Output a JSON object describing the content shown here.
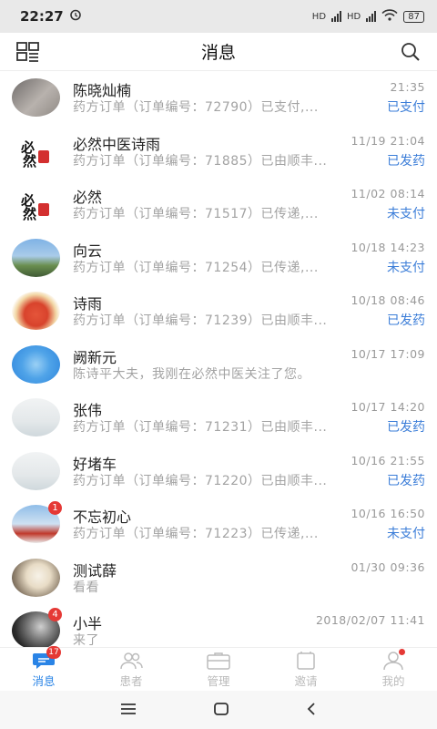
{
  "status_bar": {
    "time": "22:27",
    "network_label": "HD",
    "battery": "87"
  },
  "header": {
    "title": "消息",
    "left_icon": "qr-scan-icon",
    "right_icon": "search-icon"
  },
  "messages": [
    {
      "name": "陈晓灿楠",
      "time": "21:35",
      "preview": "药方订单（订单编号：72790）已支付,...",
      "status": "已支付",
      "badge": ""
    },
    {
      "name": "必然中医诗雨",
      "time": "11/19  21:04",
      "preview": "药方订单（订单编号：71885）已由顺丰...",
      "status": "已发药",
      "badge": ""
    },
    {
      "name": "必然",
      "time": "11/02  08:14",
      "preview": "药方订单（订单编号：71517）已传递,...",
      "status": "未支付",
      "badge": ""
    },
    {
      "name": "向云",
      "time": "10/18  14:23",
      "preview": "药方订单（订单编号：71254）已传递,...",
      "status": "未支付",
      "badge": ""
    },
    {
      "name": "诗雨",
      "time": "10/18  08:46",
      "preview": "药方订单（订单编号：71239）已由顺丰...",
      "status": "已发药",
      "badge": ""
    },
    {
      "name": "阙新元",
      "time": "10/17  17:09",
      "preview": "陈诗平大夫，我刚在必然中医关注了您。",
      "status": "",
      "badge": ""
    },
    {
      "name": "张伟",
      "time": "10/17  14:20",
      "preview": "药方订单（订单编号：71231）已由顺丰...",
      "status": "已发药",
      "badge": ""
    },
    {
      "name": "好堵车",
      "time": "10/16  21:55",
      "preview": "药方订单（订单编号：71220）已由顺丰...",
      "status": "已发药",
      "badge": ""
    },
    {
      "name": "不忘初心",
      "time": "10/16  16:50",
      "preview": "药方订单（订单编号：71223）已传递,...",
      "status": "未支付",
      "badge": "1"
    },
    {
      "name": "测试薛",
      "time": "01/30  09:36",
      "preview": "看看",
      "status": "",
      "badge": ""
    },
    {
      "name": "小半",
      "time": "2018/02/07  11:41",
      "preview": "来了",
      "status": "",
      "badge": "4"
    }
  ],
  "tabs": [
    {
      "label": "消息",
      "icon": "chat-icon",
      "badge": "17",
      "active": true
    },
    {
      "label": "患者",
      "icon": "patients-icon",
      "badge": "",
      "active": false
    },
    {
      "label": "管理",
      "icon": "briefcase-icon",
      "badge": "",
      "active": false
    },
    {
      "label": "邀请",
      "icon": "invite-icon",
      "badge": "",
      "active": false
    },
    {
      "label": "我的",
      "icon": "profile-icon",
      "badge": "",
      "active": false
    }
  ],
  "nav_bar": {
    "menu_icon": "menu-icon",
    "home_icon": "home-square-icon",
    "back_icon": "back-chevron-icon"
  },
  "colors": {
    "accent": "#2a84e6",
    "status_blue": "#3b7dd8",
    "badge_red": "#e53935"
  }
}
